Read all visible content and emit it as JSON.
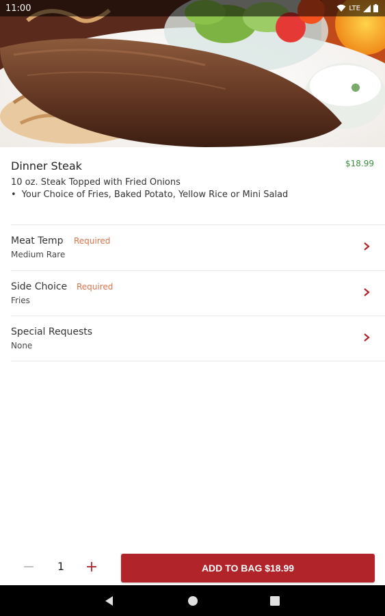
{
  "status_bar": {
    "time": "11:00",
    "network": "LTE"
  },
  "item": {
    "name": "Dinner Steak",
    "price": "$18.99",
    "description": "10 oz. Steak Topped with Fried Onions",
    "bullet": "•",
    "bullet_text": "Your Choice of Fries, Baked Potato, Yellow Rice or Mini Salad"
  },
  "options": [
    {
      "title": "Meat Temp",
      "badge": "Required",
      "value": "Medium Rare"
    },
    {
      "title": "Side Choice",
      "badge": "Required",
      "value": "Fries"
    },
    {
      "title": "Special Requests",
      "badge": "",
      "value": "None"
    }
  ],
  "quantity": {
    "minus": "−",
    "value": "1",
    "plus": "+"
  },
  "add_button": {
    "label": "ADD TO BAG $18.99"
  },
  "colors": {
    "accent": "#b1242a",
    "price": "#3d8b40",
    "required": "#d9734a"
  },
  "icons": {
    "option_chevron": "chevron-right-icon",
    "nav": [
      "back-icon",
      "home-icon",
      "recents-icon"
    ],
    "status": [
      "wifi-icon",
      "signal-icon",
      "battery-icon"
    ]
  }
}
